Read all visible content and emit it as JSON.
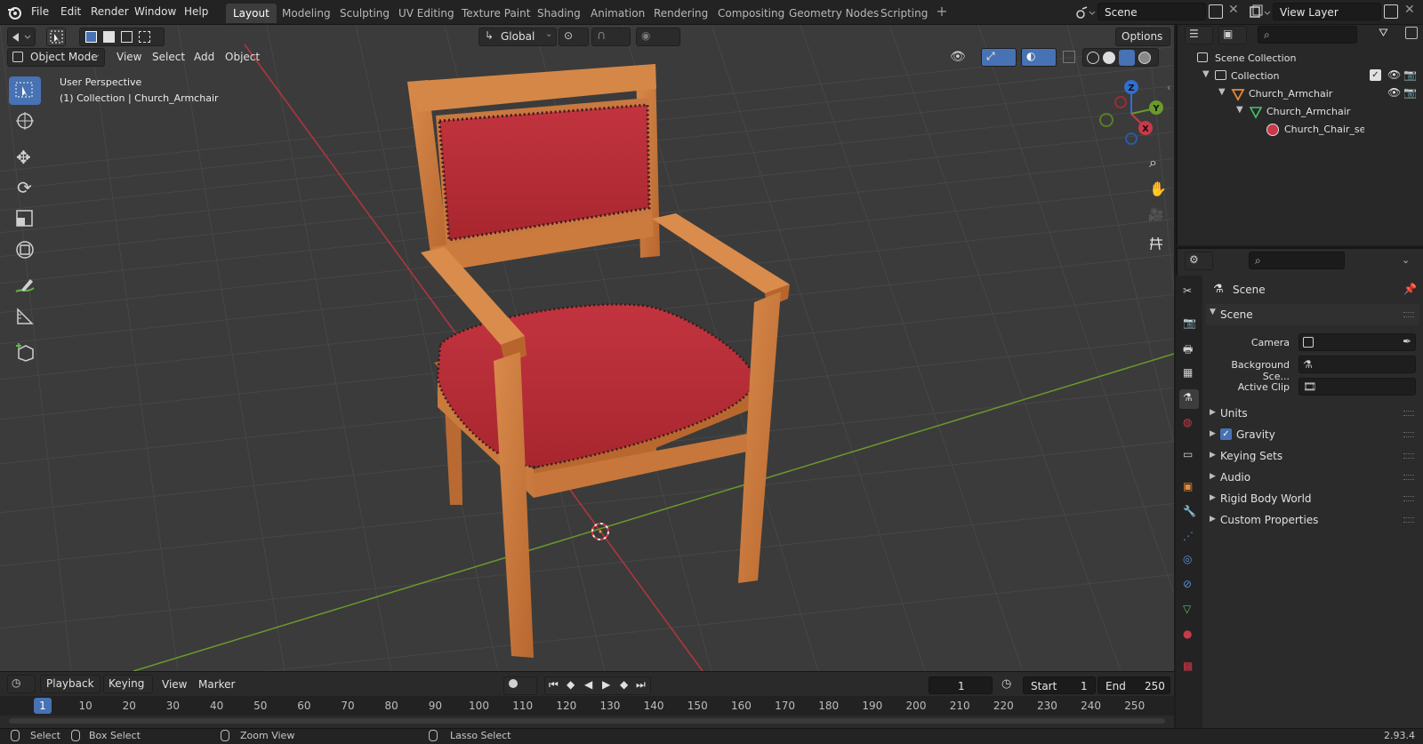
{
  "menubar": {
    "items": [
      "File",
      "Edit",
      "Render",
      "Window",
      "Help"
    ],
    "workspaces": [
      "Layout",
      "Modeling",
      "Sculpting",
      "UV Editing",
      "Texture Paint",
      "Shading",
      "Animation",
      "Rendering",
      "Compositing",
      "Geometry Nodes",
      "Scripting"
    ],
    "active_workspace": "Layout",
    "scene_name": "Scene",
    "view_layer_name": "View Layer"
  },
  "viewport": {
    "mode": "Object Mode",
    "menus": [
      "View",
      "Select",
      "Add",
      "Object"
    ],
    "orientation": "Global",
    "options_label": "Options",
    "overlay_line1": "User Perspective",
    "overlay_line2": "(1) Collection | Church_Armchair",
    "gizmo_axes": [
      "Z",
      "Y",
      "X"
    ]
  },
  "timeline": {
    "menus": [
      "Playback",
      "Keying",
      "View",
      "Marker"
    ],
    "current_frame": "1",
    "start_label": "Start",
    "start_value": "1",
    "end_label": "End",
    "end_value": "250",
    "ticks": [
      "1",
      "10",
      "20",
      "30",
      "40",
      "50",
      "60",
      "70",
      "80",
      "90",
      "100",
      "110",
      "120",
      "130",
      "140",
      "150",
      "160",
      "170",
      "180",
      "190",
      "200",
      "210",
      "220",
      "230",
      "240",
      "250"
    ]
  },
  "statusbar": {
    "select": "Select",
    "box_select": "Box Select",
    "zoom_view": "Zoom View",
    "lasso_select": "Lasso Select",
    "version": "2.93.4"
  },
  "outliner": {
    "scene_collection": "Scene Collection",
    "collection": "Collection",
    "object": "Church_Armchair",
    "mesh": "Church_Armchair",
    "material": "Church_Chair_set"
  },
  "properties": {
    "context_title": "Scene",
    "panel_scene": "Scene",
    "camera_label": "Camera",
    "background_label": "Background Sce...",
    "active_clip_label": "Active Clip",
    "panels": [
      "Units",
      "Gravity",
      "Keying Sets",
      "Audio",
      "Rigid Body World",
      "Custom Properties"
    ]
  },
  "colors": {
    "accent": "#4772b3",
    "x_axis": "#c8394a",
    "y_axis": "#6a9a2b",
    "z_axis": "#2f6fd1",
    "chair_wood": "#c8793e",
    "chair_fabric": "#b52b33"
  }
}
